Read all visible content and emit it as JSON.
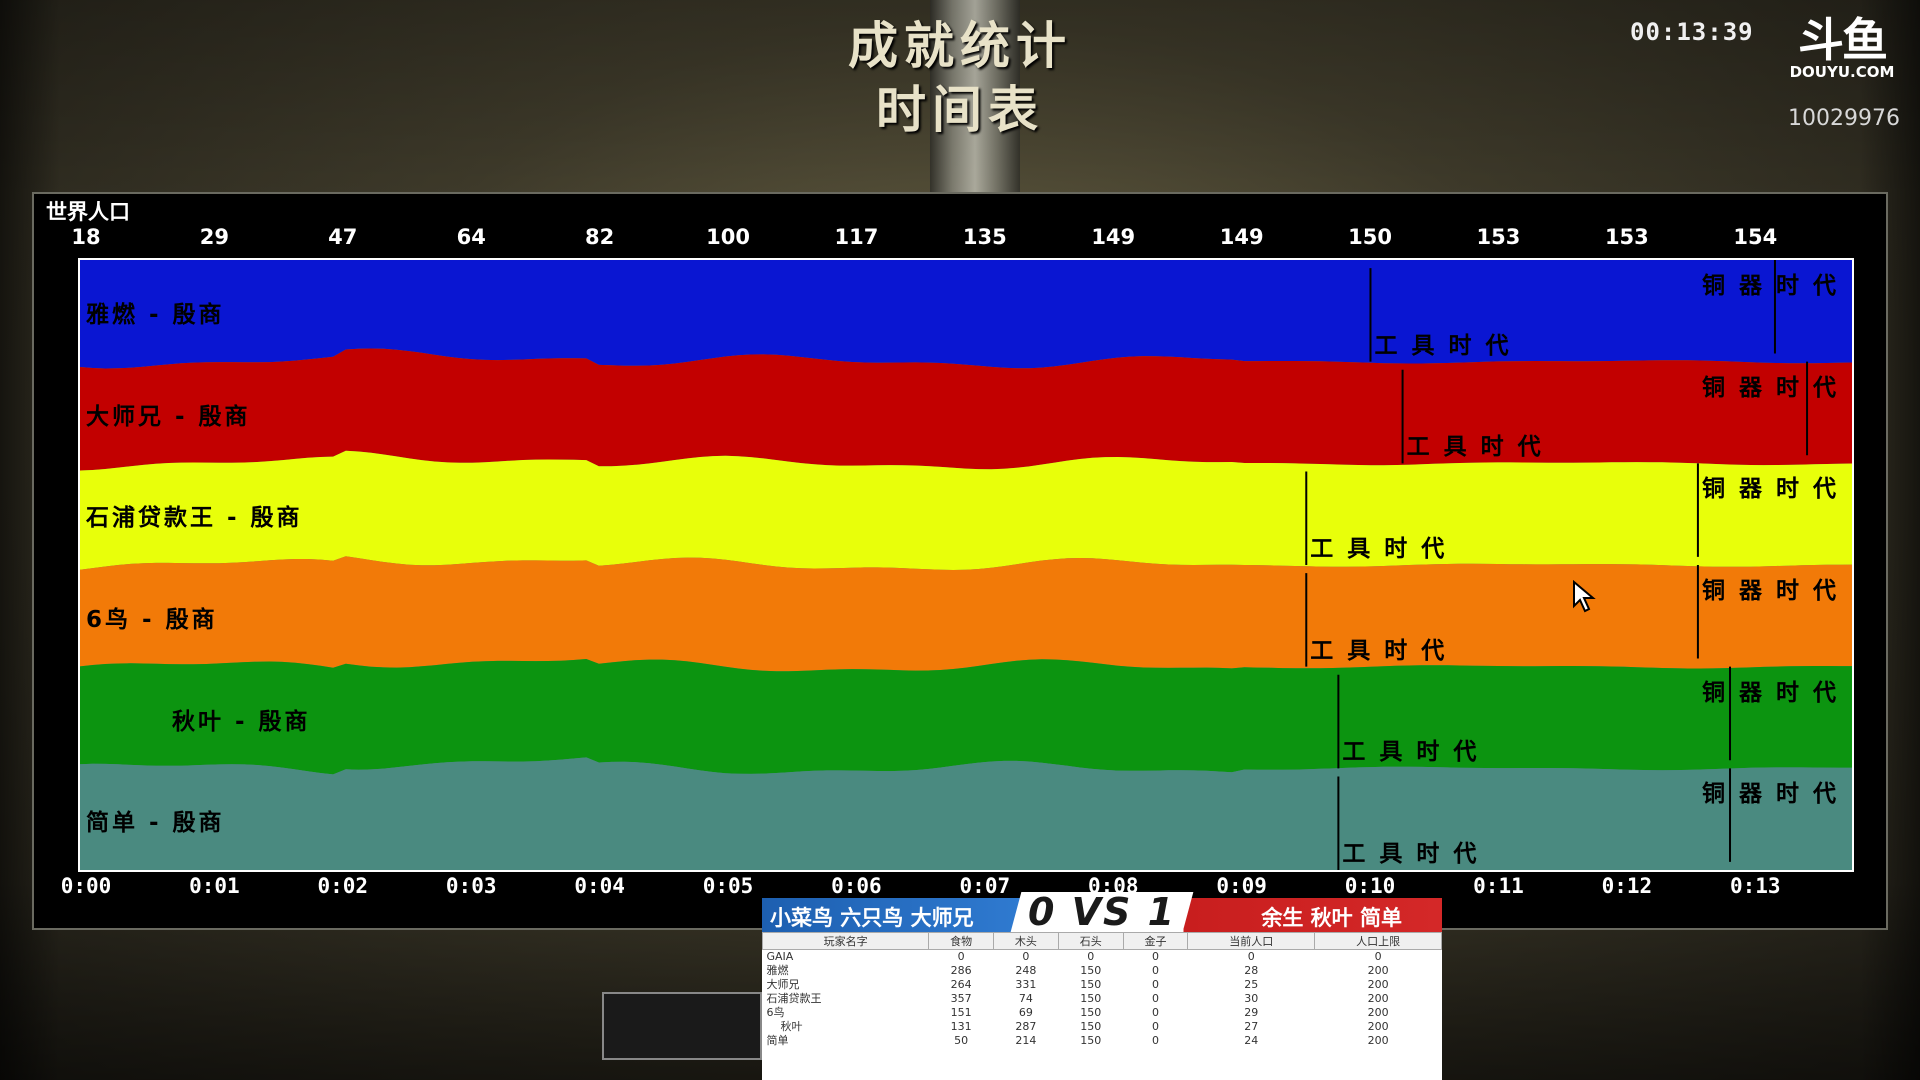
{
  "window": {
    "title_line1": "成就统计",
    "title_line2": "时间表",
    "stream_clock": "00:13:39",
    "logo_mark": "斗鱼",
    "logo_site": "DOUYU.COM",
    "room_id": "10029976"
  },
  "colors": {
    "p1": "#0a16d2",
    "p2": "#c20000",
    "p3": "#e8ff0a",
    "p4": "#f27a08",
    "p5": "#0c9410",
    "p6": "#4a8a80",
    "chart_bg": "#000000",
    "scoreboard_blue": "#1d5fb0",
    "scoreboard_red": "#c81e1e"
  },
  "chart_data": {
    "type": "area",
    "stacked": true,
    "title": "世界人口",
    "population_ticks": [
      "18",
      "29",
      "47",
      "64",
      "82",
      "100",
      "117",
      "135",
      "149",
      "149",
      "150",
      "153",
      "153",
      "154"
    ],
    "time_ticks": [
      "0:00",
      "0:01",
      "0:02",
      "0:03",
      "0:04",
      "0:05",
      "0:06",
      "0:07",
      "0:08",
      "0:09",
      "0:10",
      "0:11",
      "0:12",
      "0:13"
    ],
    "x": [
      0,
      1,
      2,
      3,
      4,
      5,
      6,
      7,
      8,
      9,
      10,
      11,
      12,
      13
    ],
    "series": [
      {
        "name": "雅燃 - 殷商",
        "color": "#0a16d2",
        "values": [
          3,
          4,
          7,
          11,
          13,
          16,
          19,
          22,
          24,
          24,
          25,
          25,
          25,
          26
        ],
        "ages": [
          {
            "label": "工具时代",
            "time": 10.05
          },
          {
            "label": "铜器时代",
            "time": 13.2
          }
        ]
      },
      {
        "name": "大师兄 - 殷商",
        "color": "#c20000",
        "values": [
          3,
          5,
          8,
          11,
          14,
          17,
          20,
          23,
          25,
          25,
          25,
          26,
          26,
          26
        ],
        "ages": [
          {
            "label": "工具时代",
            "time": 10.3
          },
          {
            "label": "铜器时代",
            "time": 13.45
          }
        ]
      },
      {
        "name": "石浦贷款王 - 殷商",
        "color": "#e8ff0a",
        "values": [
          3,
          5,
          8,
          11,
          14,
          17,
          20,
          23,
          25,
          25,
          25,
          26,
          26,
          26
        ],
        "ages": [
          {
            "label": "工具时代",
            "time": 9.55
          },
          {
            "label": "铜器时代",
            "time": 12.6
          }
        ]
      },
      {
        "name": "6鸟 - 殷商",
        "color": "#f27a08",
        "values": [
          3,
          5,
          8,
          11,
          14,
          17,
          20,
          23,
          25,
          25,
          25,
          26,
          26,
          26
        ],
        "ages": [
          {
            "label": "工具时代",
            "time": 9.55
          },
          {
            "label": "铜器时代",
            "time": 12.6
          }
        ]
      },
      {
        "name": "秋叶 - 殷商",
        "color": "#0c9410",
        "values": [
          3,
          5,
          8,
          11,
          14,
          17,
          20,
          23,
          25,
          25,
          25,
          25,
          25,
          25
        ],
        "ages": [
          {
            "label": "工具时代",
            "time": 9.8
          },
          {
            "label": "铜器时代",
            "time": 12.85
          }
        ]
      },
      {
        "name": "简单 - 殷商",
        "color": "#4a8a80",
        "values": [
          3,
          5,
          8,
          10,
          13,
          16,
          18,
          21,
          25,
          25,
          25,
          25,
          25,
          25
        ],
        "ages": [
          {
            "label": "工具时代",
            "time": 9.8
          },
          {
            "label": "铜器时代",
            "time": 12.85
          }
        ]
      }
    ],
    "xlim": [
      0,
      13.8
    ]
  },
  "scoreboard": {
    "team_left": "小菜鸟 六只鸟 大师兄",
    "vs": "0 VS 1",
    "team_right": "余生 秋叶 简单",
    "headers": [
      "玩家名字",
      "食物",
      "木头",
      "石头",
      "金子",
      "当前人口",
      "人口上限"
    ],
    "rows": [
      [
        "GAIA",
        "0",
        "0",
        "0",
        "0",
        "0",
        "0"
      ],
      [
        "雅燃",
        "286",
        "248",
        "150",
        "0",
        "28",
        "200"
      ],
      [
        "大师兄",
        "264",
        "331",
        "150",
        "0",
        "25",
        "200"
      ],
      [
        "石浦贷款王",
        "357",
        "74",
        "150",
        "0",
        "30",
        "200"
      ],
      [
        "6鸟",
        "151",
        "69",
        "150",
        "0",
        "29",
        "200"
      ],
      [
        "    秋叶",
        "131",
        "287",
        "150",
        "0",
        "27",
        "200"
      ],
      [
        "简单",
        "50",
        "214",
        "150",
        "0",
        "24",
        "200"
      ]
    ]
  }
}
